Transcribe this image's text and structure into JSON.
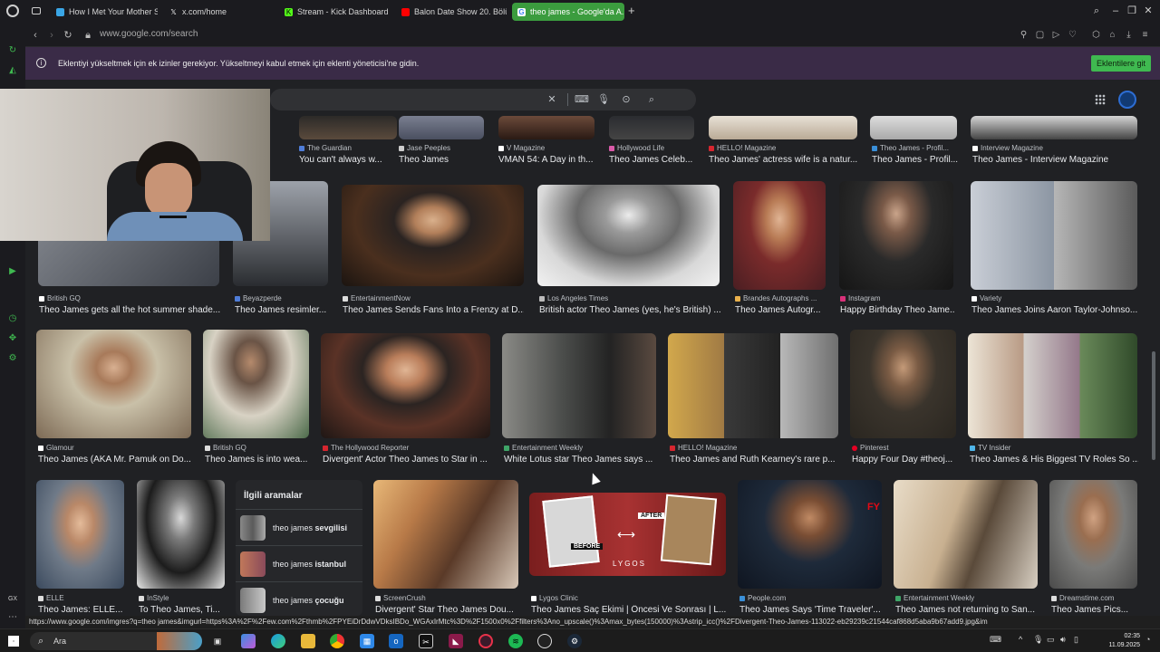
{
  "browser": {
    "tabs": [
      {
        "label": "How I Met Your Mother S...",
        "icon": "hbo-icon",
        "color": "#3aa6e6"
      },
      {
        "label": "x.com/home",
        "icon": "x-icon",
        "color": "#000000"
      },
      {
        "label": "Stream - Kick Dashboard",
        "icon": "kick-icon",
        "color": "#53fc18"
      },
      {
        "label": "Balon Date Show 20. Bölü...",
        "icon": "youtube-icon",
        "color": "#ff0000"
      },
      {
        "label": "theo james - Google'da A...",
        "icon": "google-icon",
        "color": "#ffffff"
      }
    ],
    "new_tab": "+",
    "url": "www.google.com/search"
  },
  "notice": {
    "message": "Eklentiyi yükseltmek için ek izinler gerekiyor. Yükseltmeyi kabul etmek için eklenti yöneticisi'ne gidin.",
    "button": "Eklentilere git"
  },
  "results": {
    "row1": [
      {
        "source": "The Guardian",
        "title": "You can't always w..."
      },
      {
        "source": "Jase Peeples",
        "title": "Theo James"
      },
      {
        "source": "V Magazine",
        "title": "VMAN 54: A Day in th..."
      },
      {
        "source": "Hollywood Life",
        "title": "Theo James Celeb..."
      },
      {
        "source": "HELLO! Magazine",
        "title": "Theo James' actress wife is a natur..."
      },
      {
        "source": "Theo James - Profil...",
        "title": "Theo James - Profil..."
      },
      {
        "source": "Interview Magazine",
        "title": "Theo James - Interview Magazine"
      }
    ],
    "row2": [
      {
        "source": "British GQ",
        "title": "Theo James gets all the hot summer shade..."
      },
      {
        "source": "Beyazperde",
        "title": "Theo James resimler..."
      },
      {
        "source": "EntertainmentNow",
        "title": "Theo James Sends Fans Into a Frenzy at D..."
      },
      {
        "source": "Los Angeles Times",
        "title": "British actor Theo James (yes, he's British) ..."
      },
      {
        "source": "Brandes Autographs ...",
        "title": "Theo James Autogr..."
      },
      {
        "source": "Instagram",
        "title": "Happy Birthday Theo Jame..."
      },
      {
        "source": "Variety",
        "title": "Theo James Joins Aaron Taylor-Johnso..."
      }
    ],
    "row3": [
      {
        "source": "Glamour",
        "title": "Theo James (AKA Mr. Pamuk on Do..."
      },
      {
        "source": "British GQ",
        "title": "Theo James is into wea..."
      },
      {
        "source": "The Hollywood Reporter",
        "title": "Divergent' Actor Theo James to Star in ..."
      },
      {
        "source": "Entertainment Weekly",
        "title": "White Lotus star Theo James says ..."
      },
      {
        "source": "HELLO! Magazine",
        "title": "Theo James and Ruth Kearney's rare p..."
      },
      {
        "source": "Pinterest",
        "title": "Happy Four Day #theoj..."
      },
      {
        "source": "TV Insider",
        "title": "Theo James & His Biggest TV Roles So ..."
      }
    ],
    "row4": [
      {
        "source": "ELLE",
        "title": "Theo James: ELLE..."
      },
      {
        "source": "InStyle",
        "title": "To Theo James, Ti..."
      },
      {
        "source": "ScreenCrush",
        "title": "Divergent' Star Theo James Dou..."
      },
      {
        "source": "Lygos Clinic",
        "title": "Theo James Saç Ekimi | Öncesi Ve Sonrası | L..."
      },
      {
        "source": "People.com",
        "title": "Theo James Says 'Time Traveler'..."
      },
      {
        "source": "Entertainment Weekly",
        "title": "Theo James not returning to San..."
      },
      {
        "source": "Dreamstime.com",
        "title": "Theo James Pics..."
      }
    ]
  },
  "related": {
    "heading": "İlgili aramalar",
    "items": [
      {
        "prefix": "theo james ",
        "bold": "sevgilisi"
      },
      {
        "prefix": "theo james ",
        "bold": "istanbul"
      },
      {
        "prefix": "theo james ",
        "bold": "çocuğu"
      }
    ]
  },
  "overlay_labels": {
    "before": "BEFORE",
    "after": "AFTER",
    "clinic": "LYGOS"
  },
  "status_url": "https://www.google.com/imgres?q=theo james&imgurl=https%3A%2F%2Few.com%2Fthmb%2FPYEiDrDdwVDksIBDo_WGAxIrMtc%3D%2F1500x0%2Ffilters%3Ano_upscale()%3Amax_bytes(150000)%3Astrip_icc()%2FDivergent-Theo-James-113022-eb29239c21544caf868d5aba9b67add9.jpg&im",
  "taskbar": {
    "search_placeholder": "Ara",
    "time": "02:35",
    "date": "11.09.2025"
  }
}
